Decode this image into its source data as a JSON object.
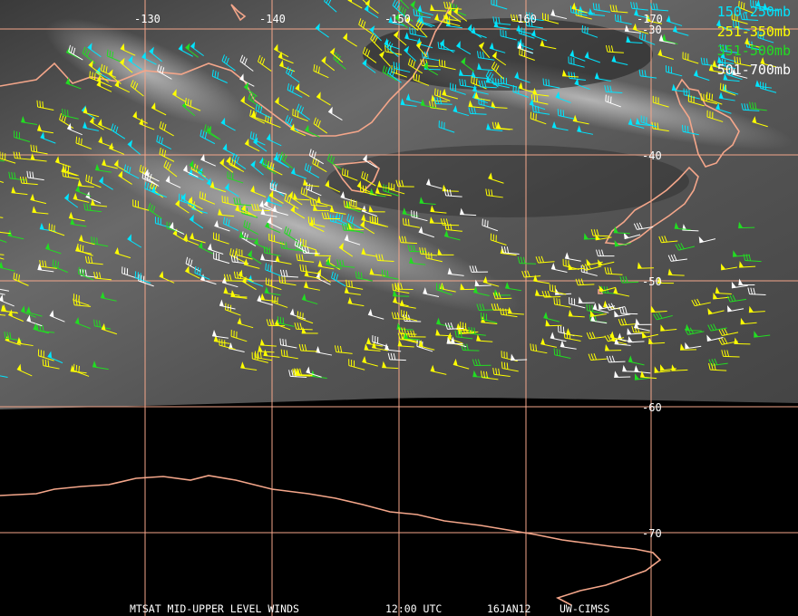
{
  "map": {
    "longitude_labels": [
      "-130",
      "-140",
      "-150",
      "-160",
      "-170"
    ],
    "latitude_labels": [
      "-30",
      "-40",
      "-50",
      "-60",
      "-70"
    ]
  },
  "legend": [
    {
      "label": "150-250mb",
      "color": "#00e5ff"
    },
    {
      "label": "251-350mb",
      "color": "#ffff00"
    },
    {
      "label": "351-500mb",
      "color": "#22dd22"
    },
    {
      "label": "501-700mb",
      "color": "#ffffff"
    }
  ],
  "footer": {
    "product": "MTSAT MID-UPPER LEVEL WINDS",
    "time": "12:00 UTC",
    "date": "16JAN12",
    "source": "UW-CIMSS"
  },
  "colors": {
    "grid": "#f4a68a",
    "coastline": "#f4a68a",
    "background": "#000000"
  }
}
